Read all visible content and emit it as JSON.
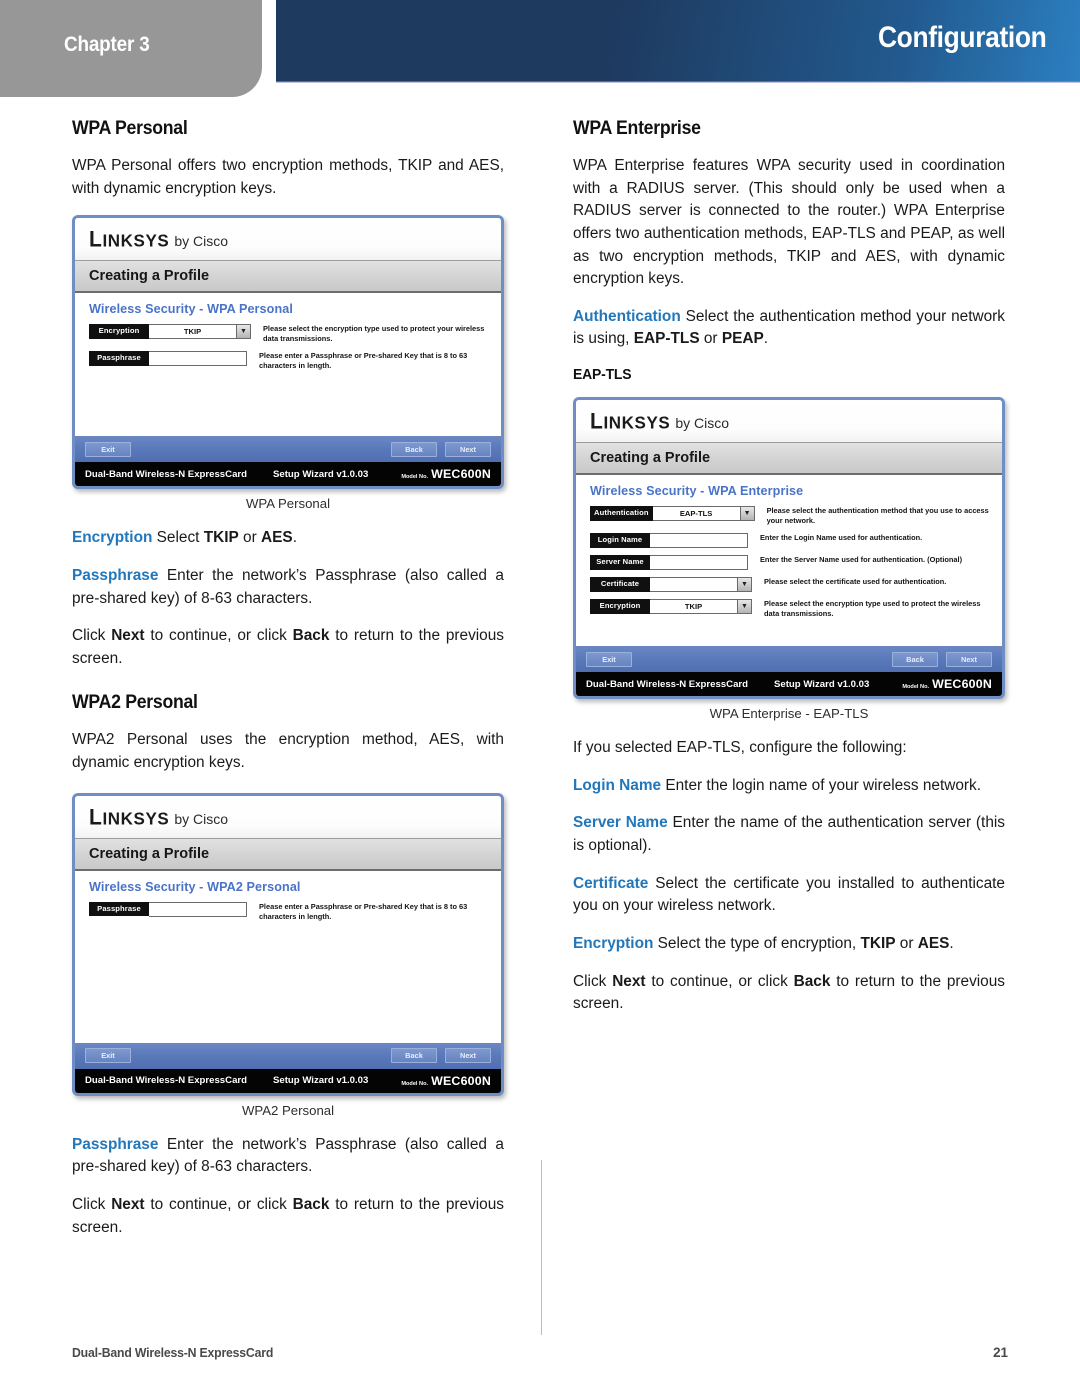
{
  "header": {
    "chapter": "Chapter 3",
    "title": "Configuration",
    "accent_dark": "#1e3a5f",
    "accent_light": "#2c7fc0",
    "tab_color": "#979797"
  },
  "left_column": {
    "section1_heading": "WPA Personal",
    "section1_paragraph": "WPA Personal offers two encryption methods, TKIP and AES, with dynamic encryption keys.",
    "figure1_caption": "WPA Personal",
    "encryption_term": "Encryption",
    "encryption_text_a": " Select ",
    "encryption_bold_1": "TKIP",
    "encryption_text_b": " or ",
    "encryption_bold_2": "AES",
    "encryption_text_c": ".",
    "passphrase_term": "Passphrase",
    "passphrase_text": " Enter the network’s Passphrase (also called a pre-shared key) of 8-63 characters.",
    "click_text_a": "Click ",
    "click_bold_next": "Next",
    "click_text_b": " to continue, or click ",
    "click_bold_back": "Back",
    "click_text_c": " to return to the previous screen.",
    "section2_heading": "WPA2 Personal",
    "section2_paragraph": "WPA2 Personal uses the encryption method, AES, with dynamic encryption keys.",
    "figure2_caption": "WPA2 Personal",
    "passphrase2_term": "Passphrase",
    "passphrase2_text": " Enter the network’s Passphrase (also called a pre-shared key) of 8-63 characters."
  },
  "right_column": {
    "section1_heading": "WPA Enterprise",
    "section1_paragraph": "WPA Enterprise features WPA security used in coordination with a RADIUS server. (This should only be used when a RADIUS server is connected to the router.) WPA Enterprise offers two authentication methods, EAP-TLS and PEAP, as well as two encryption methods, TKIP and AES, with dynamic encryption keys.",
    "authentication_term": "Authentication",
    "authentication_text_a": " Select the authentication method your network is using, ",
    "authentication_bold_1": "EAP-TLS",
    "authentication_text_b": " or ",
    "authentication_bold_2": "PEAP",
    "authentication_text_c": ".",
    "subsection_heading": "EAP-TLS",
    "figure1_caption": "WPA Enterprise - EAP-TLS",
    "intro_text": "If you selected EAP-TLS, configure the following:",
    "login_term": "Login Name",
    "login_text": " Enter the login name of your wireless network.",
    "server_term": "Server Name",
    "server_text": " Enter the name of the authentication server (this is optional).",
    "certificate_term": "Certificate",
    "certificate_text": " Select the certificate you installed to authenticate you on your wireless network.",
    "encryption_term": "Encryption",
    "encryption_text_a": " Select the type of encryption, ",
    "encryption_bold_1": "TKIP",
    "encryption_text_b": " or ",
    "encryption_bold_2": "AES",
    "encryption_text_c": ".",
    "click_text_a": "Click ",
    "click_bold_next": "Next",
    "click_text_b": " to continue, or click ",
    "click_bold_back": "Back",
    "click_text_c": " to return to the previous screen."
  },
  "screenshots": {
    "brand_first": "L",
    "brand_rest": "INKSYS",
    "brand_by": "by Cisco",
    "window_title": "Creating a Profile",
    "footer_product": "Dual-Band Wireless-N ExpressCard",
    "footer_wizard": "Setup Wizard v1.0.03",
    "footer_modelno_label": "Model No.",
    "footer_model": "WEC600N",
    "btn_exit": "Exit",
    "btn_back": "Back",
    "btn_next": "Next",
    "caret_glyph": "▼",
    "wpa_personal": {
      "heading": "Wireless Security - WPA Personal",
      "fields": [
        {
          "label": "Encryption",
          "value": "TKIP",
          "has_dropdown": true,
          "help": "Please select the encryption type used to protect your wireless data transmissions."
        },
        {
          "label": "Passphrase",
          "value": "",
          "has_dropdown": false,
          "help": "Please enter a Passphrase or Pre-shared Key that is 8 to 63 characters in length."
        }
      ]
    },
    "wpa2_personal": {
      "heading": "Wireless Security - WPA2 Personal",
      "fields": [
        {
          "label": "Passphrase",
          "value": "",
          "has_dropdown": false,
          "help": "Please enter a Passphrase or Pre-shared Key that is 8 to 63 characters in length."
        }
      ]
    },
    "wpa_enterprise": {
      "heading": "Wireless Security - WPA Enterprise",
      "fields": [
        {
          "label": "Authentication",
          "value": "EAP-TLS",
          "has_dropdown": true,
          "help": "Please select the authentication method that you use to access your network."
        },
        {
          "label": "Login Name",
          "value": "",
          "has_dropdown": false,
          "help": "Enter the Login Name used for authentication."
        },
        {
          "label": "Server Name",
          "value": "",
          "has_dropdown": false,
          "help": "Enter the Server Name used for authentication. (Optional)"
        },
        {
          "label": "Certificate",
          "value": "",
          "has_dropdown": true,
          "help": "Please select the certificate used for authentication."
        },
        {
          "label": "Encryption",
          "value": "TKIP",
          "has_dropdown": true,
          "help": "Please select the encryption type used to protect the wireless data transmissions."
        }
      ]
    }
  },
  "footer": {
    "document": "Dual-Band Wireless-N ExpressCard",
    "page_number": "21"
  }
}
